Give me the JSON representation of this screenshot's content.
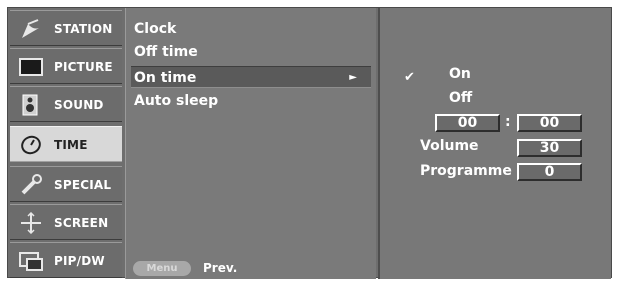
{
  "menu": {
    "tabs": [
      {
        "label": "STATION",
        "icon": "satellite-dish-icon"
      },
      {
        "label": "PICTURE",
        "icon": "tv-screen-icon"
      },
      {
        "label": "SOUND",
        "icon": "speaker-icon"
      },
      {
        "label": "TIME",
        "icon": "clock-icon",
        "selected": true
      },
      {
        "label": "SPECIAL",
        "icon": "wrench-icon"
      },
      {
        "label": "SCREEN",
        "icon": "crosshair-icon"
      },
      {
        "label": "PIP/DW",
        "icon": "pip-icon"
      }
    ]
  },
  "submenu": {
    "items": [
      {
        "label": "Clock"
      },
      {
        "label": "Off time"
      },
      {
        "label": "On time",
        "active": true,
        "arrow": "►"
      },
      {
        "label": "Auto sleep"
      }
    ],
    "footer": {
      "menu_key": "Menu",
      "action": "Prev."
    }
  },
  "on_time": {
    "check": "✔",
    "on_label": "On",
    "off_label": "Off",
    "hour": "00",
    "separator": ":",
    "minute": "00",
    "volume_label": "Volume",
    "volume_value": "30",
    "programme_label": "Programme",
    "programme_value": "0"
  }
}
